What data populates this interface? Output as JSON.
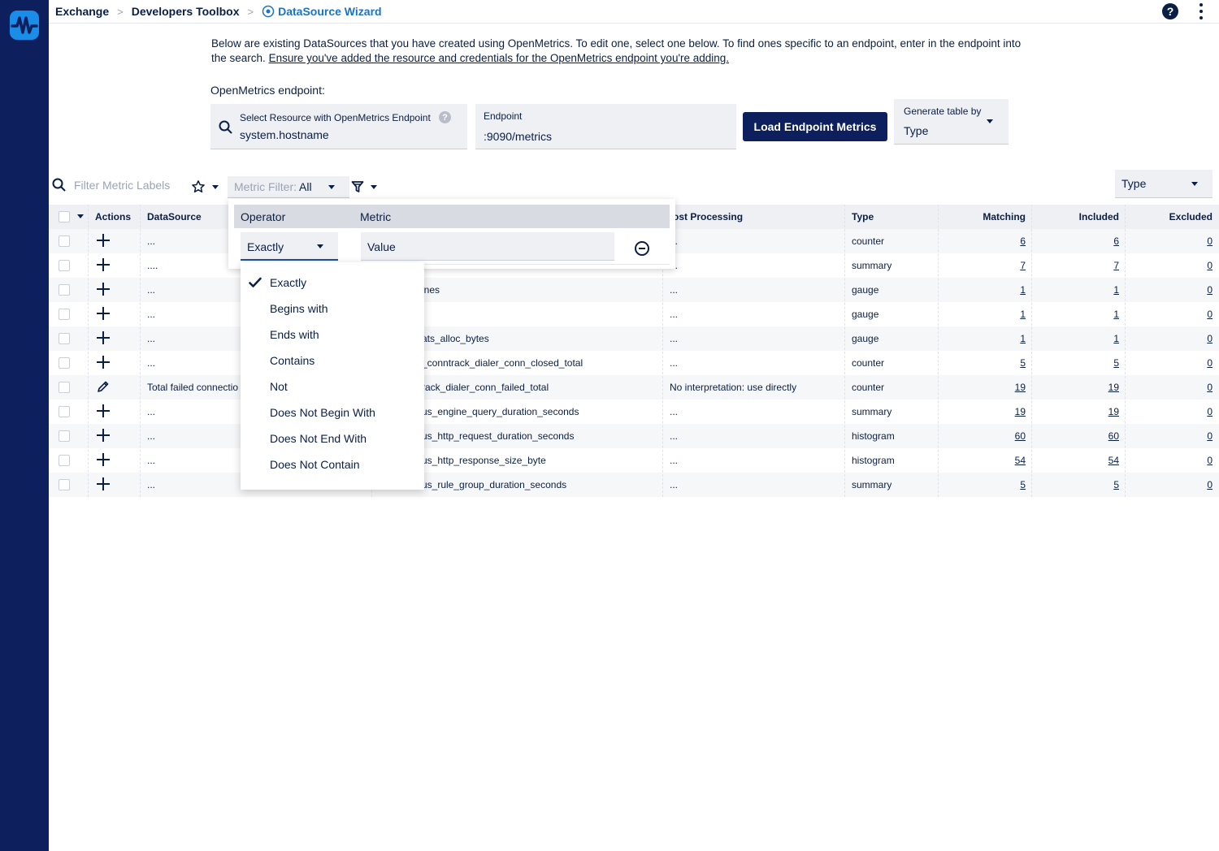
{
  "breadcrumb": {
    "items": [
      "Exchange",
      "Developers Toolbox"
    ],
    "current": "DataSource Wizard",
    "separator": ">"
  },
  "header": {
    "help_label": "?"
  },
  "intro": {
    "text": "Below are existing DataSources that you have created using OpenMetrics. To edit one, select one below. To find ones specific to an endpoint, enter in the endpoint into the search.",
    "link": "Ensure you've added the resource and credentials for the OpenMetrics endpoint you're adding."
  },
  "endpoint_section": {
    "label": "OpenMetrics endpoint:",
    "resource": {
      "label": "Select Resource with OpenMetrics Endpoint",
      "value": "system.hostname"
    },
    "endpoint": {
      "label": "Endpoint",
      "value": ":9090/metrics"
    },
    "load_button": "Load Endpoint Metrics",
    "generate": {
      "label": "Generate table by",
      "value": "Type"
    }
  },
  "toolbar": {
    "search_placeholder": "Filter Metric Labels",
    "metric_filter_label": "Metric Filter:",
    "metric_filter_value": "All",
    "type_select": "Type"
  },
  "table": {
    "headers": {
      "actions": "Actions",
      "datasource": "DataSource",
      "post_processing": "ost Processing",
      "type": "Type",
      "matching": "Matching",
      "included": "Included",
      "excluded": "Excluded"
    },
    "rows": [
      {
        "action": "add",
        "datasource": "...",
        "metric": "",
        "post": "...",
        "type": "counter",
        "matching": "6",
        "included": "6",
        "excluded": "0"
      },
      {
        "action": "add",
        "datasource": "....",
        "metric": "",
        "post": "...",
        "type": "summary",
        "matching": "7",
        "included": "7",
        "excluded": "0"
      },
      {
        "action": "add",
        "datasource": "...",
        "metric": "ines",
        "post": "...",
        "type": "gauge",
        "matching": "1",
        "included": "1",
        "excluded": "0"
      },
      {
        "action": "add",
        "datasource": "...",
        "metric": "",
        "post": "...",
        "type": "gauge",
        "matching": "1",
        "included": "1",
        "excluded": "0"
      },
      {
        "action": "add",
        "datasource": "...",
        "metric": "ats_alloc_bytes",
        "post": "...",
        "type": "gauge",
        "matching": "1",
        "included": "1",
        "excluded": "0"
      },
      {
        "action": "add",
        "datasource": "...",
        "metric": "_conntrack_dialer_conn_closed_total",
        "post": "...",
        "type": "counter",
        "matching": "5",
        "included": "5",
        "excluded": "0"
      },
      {
        "action": "edit",
        "datasource": "Total failed connectio",
        "metric": "rack_dialer_conn_failed_total",
        "post": "No interpretation: use directly",
        "type": "counter",
        "matching": "19",
        "included": "19",
        "excluded": "0"
      },
      {
        "action": "add",
        "datasource": "...",
        "metric": "us_engine_query_duration_seconds",
        "post": "...",
        "type": "summary",
        "matching": "19",
        "included": "19",
        "excluded": "0"
      },
      {
        "action": "add",
        "datasource": "...",
        "metric": "us_http_request_duration_seconds",
        "post": "...",
        "type": "histogram",
        "matching": "60",
        "included": "60",
        "excluded": "0"
      },
      {
        "action": "add",
        "datasource": "...",
        "metric": "us_http_response_size_byte",
        "post": "...",
        "type": "histogram",
        "matching": "54",
        "included": "54",
        "excluded": "0"
      },
      {
        "action": "add",
        "datasource": "...",
        "metric": "us_rule_group_duration_seconds",
        "post": "...",
        "type": "summary",
        "matching": "5",
        "included": "5",
        "excluded": "0"
      }
    ]
  },
  "filter_popup": {
    "operator_header": "Operator",
    "metric_header": "Metric",
    "operator_value": "Exactly",
    "value_placeholder": "Value"
  },
  "operator_menu": {
    "selected": "Exactly",
    "options": [
      "Exactly",
      "Begins with",
      "Ends with",
      "Contains",
      "Not",
      "Does Not Begin With",
      "Does Not End With",
      "Does Not Contain"
    ]
  }
}
